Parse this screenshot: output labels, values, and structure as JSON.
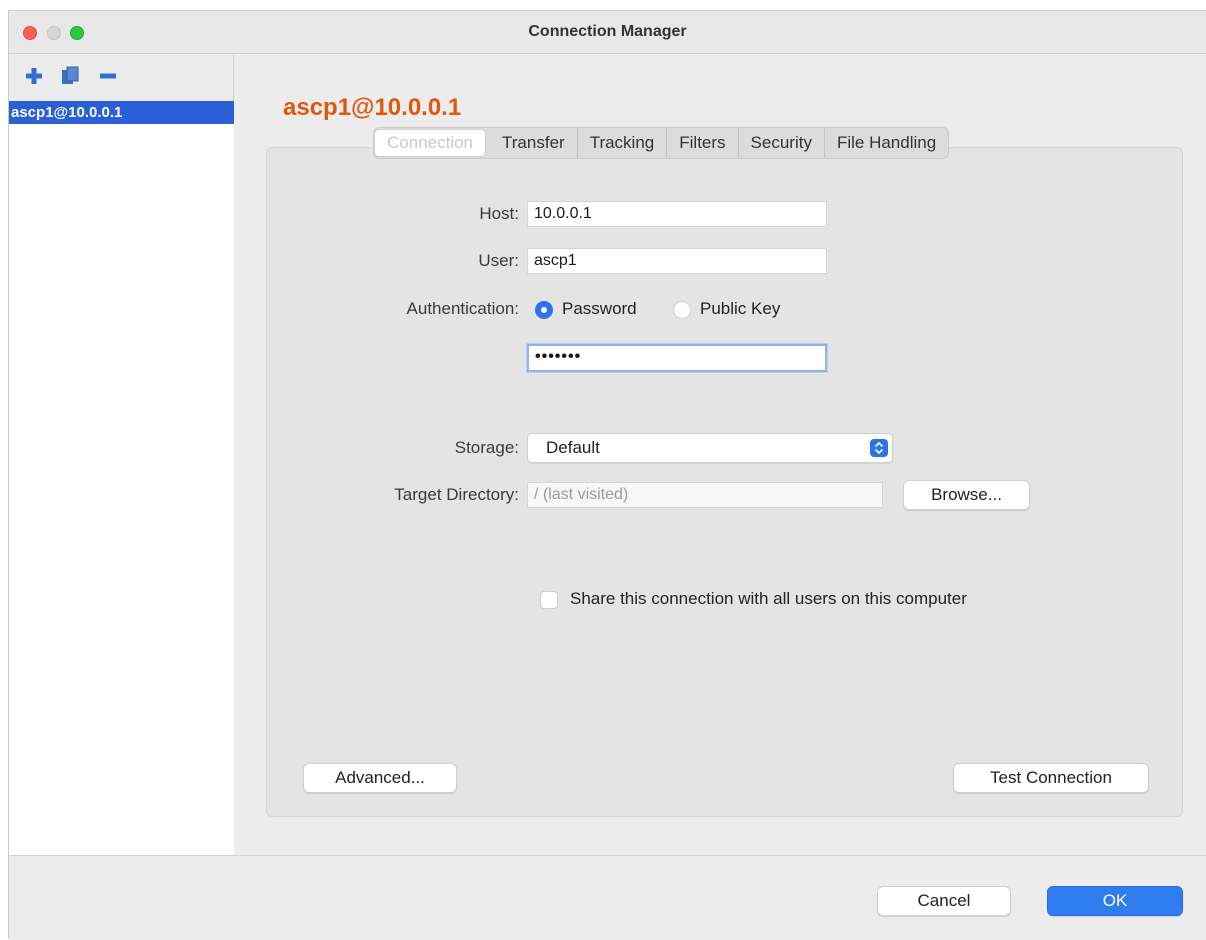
{
  "window": {
    "title": "Connection Manager"
  },
  "sidebar": {
    "toolbar": [
      {
        "icon": "plus-icon",
        "action": "add"
      },
      {
        "icon": "duplicate-icon",
        "action": "duplicate"
      },
      {
        "icon": "minus-icon",
        "action": "remove"
      }
    ],
    "connections": [
      {
        "label": "ascp1@10.0.0.1",
        "selected": true
      }
    ]
  },
  "main": {
    "connection_title": "ascp1@10.0.0.1",
    "tabs": [
      {
        "label": "Connection",
        "active": true
      },
      {
        "label": "Transfer",
        "active": false
      },
      {
        "label": "Tracking",
        "active": false
      },
      {
        "label": "Filters",
        "active": false
      },
      {
        "label": "Security",
        "active": false
      },
      {
        "label": "File Handling",
        "active": false
      }
    ],
    "form": {
      "host_label": "Host:",
      "host_value": "10.0.0.1",
      "user_label": "User:",
      "user_value": "ascp1",
      "auth_label": "Authentication:",
      "auth_options": [
        {
          "label": "Password",
          "selected": true
        },
        {
          "label": "Public Key",
          "selected": false
        }
      ],
      "password_value": "•••••••",
      "storage_label": "Storage:",
      "storage_value": "Default",
      "target_dir_label": "Target Directory:",
      "target_dir_placeholder": "/ (last visited)",
      "browse_label": "Browse...",
      "share_label": "Share this connection with all users on this computer",
      "share_checked": false
    },
    "advanced_label": "Advanced...",
    "test_connection_label": "Test Connection"
  },
  "footer": {
    "cancel_label": "Cancel",
    "ok_label": "OK"
  },
  "colors": {
    "accent": "#2f7cf0",
    "selection": "#2a5fd8",
    "connection_title": "#e2570f",
    "traffic_close": "#fc5f57",
    "traffic_max": "#2bc840"
  }
}
